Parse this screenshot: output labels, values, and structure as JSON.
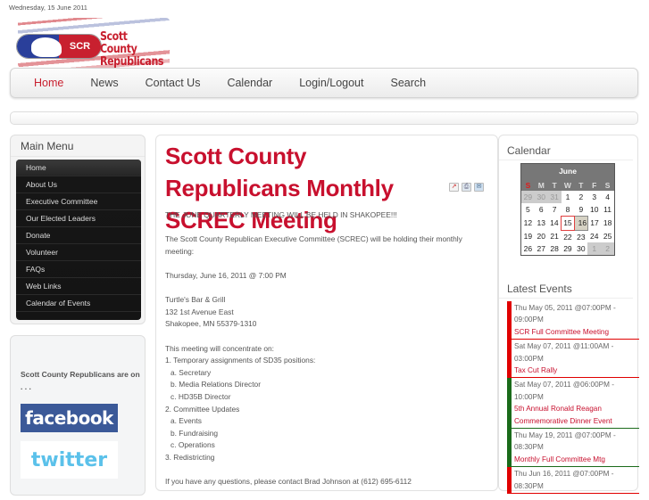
{
  "header": {
    "date": "Wednesday, 15 June 2011",
    "logo": {
      "badge_text": "SCR",
      "name_line1": "Scott County",
      "name_line2": "Republicans"
    }
  },
  "nav": {
    "items": [
      {
        "label": "Home",
        "active": true
      },
      {
        "label": "News"
      },
      {
        "label": "Contact Us"
      },
      {
        "label": "Calendar"
      },
      {
        "label": "Login/Logout"
      },
      {
        "label": "Search"
      }
    ]
  },
  "sidebar": {
    "main_menu_title": "Main Menu",
    "items": [
      {
        "label": "Home"
      },
      {
        "label": "About Us"
      },
      {
        "label": "Executive Committee"
      },
      {
        "label": "Our Elected Leaders"
      },
      {
        "label": "Donate"
      },
      {
        "label": "Volunteer"
      },
      {
        "label": "FAQs"
      },
      {
        "label": "Web Links"
      },
      {
        "label": "Calendar of Events"
      }
    ],
    "social_text": "Scott County Republicans are on . . .",
    "facebook_label": "facebook",
    "twitter_label": "twitter"
  },
  "article": {
    "title": "Scott County Republicans Monthly SCREC Meeting",
    "icons": [
      "pdf-icon",
      "print-icon",
      "email-icon"
    ],
    "intro": "THE JUNE QUARTERLY MEETING WILL BE HELD IN SHAKOPEE!!!",
    "para1": "The Scott County Republican Executive Committee (SCREC) will be holding their monthly meeting:",
    "when": "Thursday, June 16, 2011 @ 7:00 PM",
    "address": [
      "Turtle's Bar & Grill",
      "132 1st Avenue East",
      "Shakopee, MN 55379-1310"
    ],
    "agenda_intro": "This meeting will concentrate on:",
    "agenda": [
      {
        "text": "1. Temporary assignments of SD35 positions:",
        "indent": false
      },
      {
        "text": "a. Secretary",
        "indent": true
      },
      {
        "text": "b. Media Relations Director",
        "indent": true
      },
      {
        "text": "c. HD35B Director",
        "indent": true
      },
      {
        "text": "2. Committee Updates",
        "indent": false
      },
      {
        "text": "a. Events",
        "indent": true
      },
      {
        "text": "b. Fundraising",
        "indent": true
      },
      {
        "text": "c. Operations",
        "indent": true
      },
      {
        "text": "3. Redistricting",
        "indent": false
      }
    ],
    "contact": "If you have any questions, please contact Brad Johnson at (612) 695-6112"
  },
  "calendar": {
    "title": "Calendar",
    "month": "June",
    "weekdays": [
      "S",
      "M",
      "T",
      "W",
      "T",
      "F",
      "S"
    ],
    "weeks": [
      [
        {
          "d": "29",
          "o": true
        },
        {
          "d": "30",
          "o": true
        },
        {
          "d": "31",
          "o": true
        },
        {
          "d": "1"
        },
        {
          "d": "2"
        },
        {
          "d": "3"
        },
        {
          "d": "4"
        }
      ],
      [
        {
          "d": "5"
        },
        {
          "d": "6"
        },
        {
          "d": "7"
        },
        {
          "d": "8"
        },
        {
          "d": "9"
        },
        {
          "d": "10"
        },
        {
          "d": "11"
        }
      ],
      [
        {
          "d": "12"
        },
        {
          "d": "13"
        },
        {
          "d": "14"
        },
        {
          "d": "15",
          "today": true
        },
        {
          "d": "16",
          "event": true
        },
        {
          "d": "17"
        },
        {
          "d": "18"
        }
      ],
      [
        {
          "d": "19"
        },
        {
          "d": "20"
        },
        {
          "d": "21"
        },
        {
          "d": "22"
        },
        {
          "d": "23"
        },
        {
          "d": "24"
        },
        {
          "d": "25"
        }
      ],
      [
        {
          "d": "26"
        },
        {
          "d": "27"
        },
        {
          "d": "28"
        },
        {
          "d": "29"
        },
        {
          "d": "30"
        },
        {
          "d": "1",
          "o": true
        },
        {
          "d": "2",
          "o": true
        }
      ]
    ]
  },
  "latest_events": {
    "title": "Latest Events",
    "items": [
      {
        "when": "Thu May 05, 2011 @07:00PM - 09:00PM",
        "name": "SCR Full Committee Meeting",
        "color": "red"
      },
      {
        "when": "Sat May 07, 2011 @11:00AM - 03:00PM",
        "name": "Tax Cut Rally",
        "color": "red"
      },
      {
        "when": "Sat May 07, 2011 @06:00PM - 10:00PM",
        "name": "5th Annual Ronald Reagan Commemorative Dinner Event",
        "color": "green"
      },
      {
        "when": "Thu May 19, 2011 @07:00PM - 08:30PM",
        "name": "Monthly Full Committee Mtg",
        "color": "green"
      },
      {
        "when": "Thu Jun 16, 2011 @07:00PM - 08:30PM",
        "name": "",
        "color": "red"
      }
    ]
  }
}
